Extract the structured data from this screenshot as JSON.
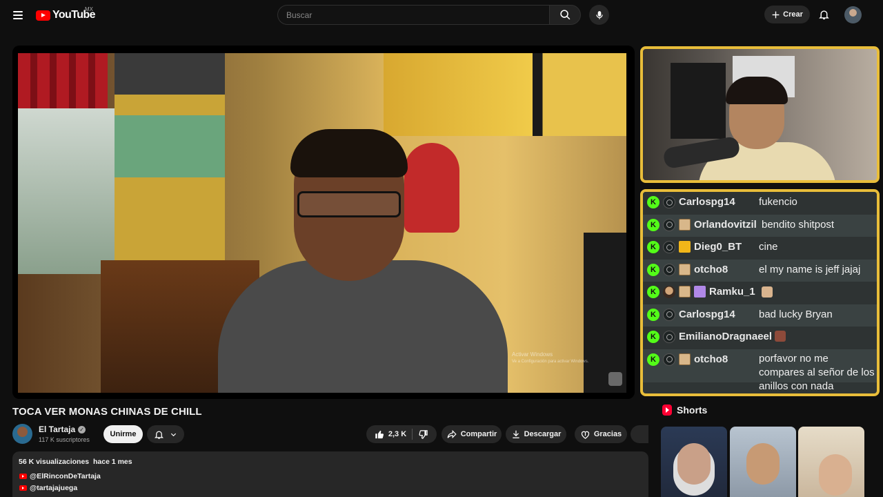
{
  "header": {
    "logo_text": "YouTube",
    "region": "MX",
    "search_placeholder": "Buscar",
    "create_label": "Crear"
  },
  "player": {
    "watermark_title": "Activar Windows",
    "watermark_sub": "Ve a Configuración para activar Windows."
  },
  "chat": {
    "messages": [
      {
        "user": "Carlospg14",
        "text": "fukencio"
      },
      {
        "user": "Orlandovitzil",
        "text": "bendito shitpost"
      },
      {
        "user": "Dieg0_BT",
        "text": "cine"
      },
      {
        "user": "otcho8",
        "text": "el my name is jeff jajaj"
      },
      {
        "user": "Ramku_1",
        "text": ""
      },
      {
        "user": "Carlospg14",
        "text": "bad lucky Bryan"
      },
      {
        "user": "EmilianoDragnaeel",
        "text": ""
      },
      {
        "user": "otcho8",
        "text": "porfavor no me compares al señor de los anillos con nada"
      }
    ],
    "badge_letter": "K"
  },
  "video": {
    "title": "TOCA VER MONAS CHINAS DE CHILL",
    "channel": "El Tartaja",
    "subscribers": "117 K suscriptores",
    "join_label": "Unirme",
    "likes": "2,3 K",
    "share_label": "Compartir",
    "download_label": "Descargar",
    "thanks_label": "Gracias"
  },
  "description": {
    "views": "56 K visualizaciones",
    "date": "hace 1 mes",
    "links": [
      "@ElRinconDeTartaja",
      "@tartajajuega"
    ]
  },
  "shorts": {
    "heading": "Shorts"
  },
  "colors": {
    "accent_border": "#e8bd3a",
    "kick_green": "#53fc18",
    "youtube_red": "#ff0000"
  }
}
